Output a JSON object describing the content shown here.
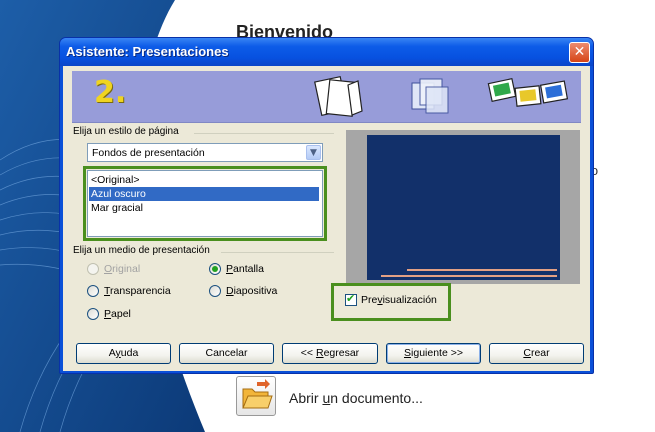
{
  "background": {
    "title": "Bienvenido",
    "side_text": "lo",
    "open_document_label_prefix": "Abrir ",
    "open_document_label_mnemonic": "u",
    "open_document_label_suffix": "n documento..."
  },
  "dialog": {
    "title": "Asistente: Presentaciones",
    "close_glyph": "✕",
    "step_number": "2.",
    "page_style": {
      "group_label": "Elija un estilo de página",
      "select_value": "Fondos de presentación",
      "options": [
        "<Original>",
        "Azul oscuro",
        "Mar gracial"
      ],
      "selected_index": 1
    },
    "medium": {
      "group_label": "Elija un medio de presentación",
      "options": [
        {
          "label_mnemonic": "O",
          "label_rest": "riginal",
          "checked": false,
          "enabled": false
        },
        {
          "label_mnemonic": "P",
          "label_rest": "antalla",
          "checked": true,
          "enabled": true
        },
        {
          "label_mnemonic": "T",
          "label_rest": "ransparencia",
          "checked": false,
          "enabled": true
        },
        {
          "label_mnemonic": "D",
          "label_rest": "iapositiva",
          "checked": false,
          "enabled": true
        },
        {
          "label_mnemonic": "P",
          "label_rest": "apel",
          "checked": false,
          "enabled": true
        }
      ]
    },
    "preview": {
      "checkbox_label_prefix": "Pre",
      "checkbox_label_mnemonic": "v",
      "checkbox_label_suffix": "isualización",
      "checked": true
    },
    "buttons": {
      "help": "Ayuda",
      "help_mnemonic": "y",
      "cancel": "Cancelar",
      "back_prefix": "<< ",
      "back_mnemonic": "R",
      "back_rest": "egresar",
      "next_mnemonic": "S",
      "next_rest": "iguiente >>",
      "create_mnemonic": "C",
      "create_rest": "rear"
    },
    "colors": {
      "highlight_border": "#4a8f1e",
      "selection": "#316ac5",
      "slide_background": "#12306a",
      "slide_accent_lines": "#e3a084"
    }
  }
}
